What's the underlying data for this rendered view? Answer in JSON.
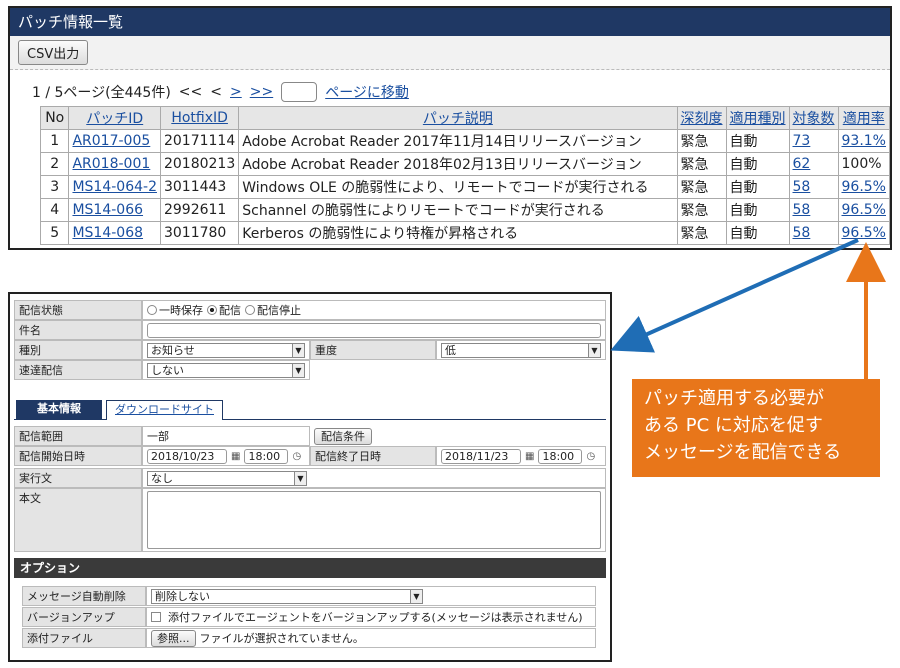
{
  "patch_list": {
    "title": "パッチ情報一覧",
    "csv_button": "CSV出力",
    "pager": {
      "status": "1 / 5ページ(全445件)",
      "first": "<<",
      "prev": "<",
      "next": ">",
      "last": ">>",
      "goto": "ページに移動"
    },
    "columns": [
      "No",
      "パッチID",
      "HotfixID",
      "パッチ説明",
      "深刻度",
      "適用種別",
      "対象数",
      "適用率"
    ],
    "rows": [
      {
        "no": "1",
        "patch_id": "AR017-005",
        "hotfix": "20171114",
        "desc": "Adobe Acrobat Reader 2017年11月14日リリースバージョン",
        "severity": "緊急",
        "type": "自動",
        "count": "73",
        "rate": "93.1%"
      },
      {
        "no": "2",
        "patch_id": "AR018-001",
        "hotfix": "20180213",
        "desc": "Adobe Acrobat Reader 2018年02月13日リリースバージョン",
        "severity": "緊急",
        "type": "自動",
        "count": "62",
        "rate": "100%"
      },
      {
        "no": "3",
        "patch_id": "MS14-064-2",
        "hotfix": "3011443",
        "desc": "Windows OLE の脆弱性により、リモートでコードが実行される",
        "severity": "緊急",
        "type": "自動",
        "count": "58",
        "rate": "96.5%"
      },
      {
        "no": "4",
        "patch_id": "MS14-066",
        "hotfix": "2992611",
        "desc": "Schannel の脆弱性によりリモートでコードが実行される",
        "severity": "緊急",
        "type": "自動",
        "count": "58",
        "rate": "96.5%"
      },
      {
        "no": "5",
        "patch_id": "MS14-068",
        "hotfix": "3011780",
        "desc": "Kerberos の脆弱性により特権が昇格される",
        "severity": "緊急",
        "type": "自動",
        "count": "58",
        "rate": "96.5%"
      }
    ]
  },
  "form": {
    "status_label": "配信状態",
    "status_options": [
      "一時保存",
      "配信",
      "配信停止"
    ],
    "status_selected": "配信",
    "subject_label": "件名",
    "subject_value": "",
    "kind_label": "種別",
    "kind_value": "お知らせ",
    "importance_label": "重度",
    "importance_value": "低",
    "urgent_label": "速達配信",
    "urgent_value": "しない",
    "tabs": [
      "基本情報",
      "ダウンロードサイト"
    ],
    "range_label": "配信範囲",
    "range_value": "一部",
    "range_button": "配信条件",
    "start_label": "配信開始日時",
    "start_date": "2018/10/23",
    "start_time": "18:00",
    "end_label": "配信終了日時",
    "end_date": "2018/11/23",
    "end_time": "18:00",
    "exec_label": "実行文",
    "exec_value": "なし",
    "body_label": "本文",
    "body_value": "",
    "options_title": "オプション",
    "autodelete_label": "メッセージ自動削除",
    "autodelete_value": "削除しない",
    "version_label": "バージョンアップ",
    "version_check_text": "添付ファイルでエージェントをバージョンアップする(メッセージは表示されません)",
    "attach_label": "添付ファイル",
    "attach_button": "参照...",
    "attach_status": "ファイルが選択されていません。"
  },
  "callout": {
    "lines": [
      "パッチ適用する必要が",
      "ある PC に対応を促す",
      "メッセージを配信できる"
    ]
  },
  "colors": {
    "titlebar": "#1f3864",
    "link": "#1a4fa0",
    "callout": "#e8761a",
    "blue_arrow": "#1f6db5"
  }
}
